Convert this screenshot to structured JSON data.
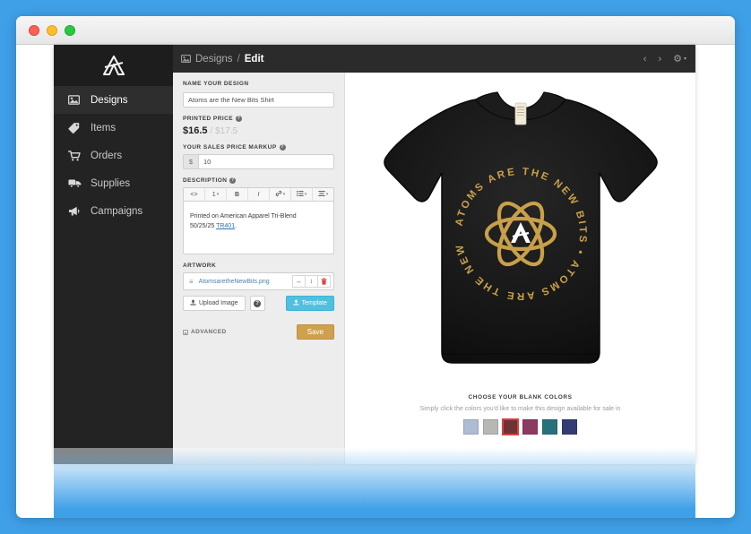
{
  "window": {
    "controls": [
      "close",
      "minimize",
      "maximize"
    ]
  },
  "sidebar": {
    "logo_name": "brand-logo",
    "items": [
      {
        "label": "Designs",
        "icon": "image-icon",
        "active": true
      },
      {
        "label": "Items",
        "icon": "tag-icon",
        "active": false
      },
      {
        "label": "Orders",
        "icon": "cart-icon",
        "active": false
      },
      {
        "label": "Supplies",
        "icon": "truck-icon",
        "active": false
      },
      {
        "label": "Campaigns",
        "icon": "megaphone-icon",
        "active": false
      }
    ]
  },
  "topbar": {
    "breadcrumb_icon": "image-icon",
    "breadcrumb_parent": "Designs",
    "breadcrumb_separator": "/",
    "breadcrumb_current": "Edit",
    "prev_label": "‹",
    "next_label": "›",
    "gear_label": "⚙",
    "gear_caret": "▾"
  },
  "form": {
    "name": {
      "label": "NAME YOUR DESIGN",
      "value": "Atoms are the New Bits Shirt",
      "placeholder": "Name your design"
    },
    "printed_price": {
      "label": "PRINTED PRICE",
      "info": "?",
      "value": "$16.5",
      "compare_value": "/ $17.5"
    },
    "markup": {
      "label": "YOUR SALES PRICE MARKUP",
      "info": "?",
      "currency": "$",
      "value": "10",
      "placeholder": "0"
    },
    "description": {
      "label": "DESCRIPTION",
      "info": "?",
      "toolbar": [
        {
          "name": "code-icon",
          "glyph": "<>",
          "caret": false
        },
        {
          "name": "heading-icon",
          "glyph": "1",
          "caret": true
        },
        {
          "name": "bold-icon",
          "glyph": "B",
          "caret": false
        },
        {
          "name": "italic-icon",
          "glyph": "I",
          "caret": false
        },
        {
          "name": "link-icon",
          "glyph": "🔗",
          "caret": true
        },
        {
          "name": "list-icon",
          "glyph": "≣",
          "caret": true
        },
        {
          "name": "align-icon",
          "glyph": "≡",
          "caret": true
        }
      ],
      "body_line1": "Printed on American Apparel Tri-Blend",
      "body_line2_prefix": "50/25/25 ",
      "body_link": "TR401",
      "body_line2_suffix": "."
    },
    "artwork": {
      "label": "ARTWORK",
      "drag_handle": "≡",
      "file_name": "AtomsaretheNewBits.png",
      "actions": [
        {
          "name": "fit-width-icon",
          "glyph": "↔"
        },
        {
          "name": "fit-height-icon",
          "glyph": "↕"
        },
        {
          "name": "delete-icon",
          "glyph": "🗑"
        }
      ],
      "upload_label": "Upload Image",
      "upload_icon": "upload-icon",
      "help_icon": "question-icon",
      "help_glyph": "?",
      "template_label": "Template",
      "template_icon": "download-icon"
    },
    "advanced_label": "ADVANCED",
    "save_label": "Save"
  },
  "preview": {
    "shirt_alt": "black-tshirt-front",
    "artwork_text": "ATOMS ARE THE NEW BITS • ATOMS ARE THE NEW BITS •",
    "artwork_mark": "atom-logo",
    "colors_title": "CHOOSE YOUR BLANK COLORS",
    "colors_subtitle": "Simply click the colors you'd like to make this design available for sale in",
    "swatches": [
      {
        "name": "swatch-light-blue",
        "hex": "#aebcd2",
        "selected": false
      },
      {
        "name": "swatch-grey",
        "hex": "#b7b8b4",
        "selected": false
      },
      {
        "name": "swatch-dark-red",
        "hex": "#6f3237",
        "selected": true
      },
      {
        "name": "swatch-magenta",
        "hex": "#8d3a63",
        "selected": false
      },
      {
        "name": "swatch-teal",
        "hex": "#28717a",
        "selected": false
      },
      {
        "name": "swatch-navy",
        "hex": "#333d72",
        "selected": false
      }
    ]
  },
  "theme": {
    "accent_blue": "#4fc0e0",
    "save_gold": "#cfa14e",
    "sidebar_bg": "#232323",
    "topbar_bg": "#2b2b2b",
    "page_bg": "#3fa0e8",
    "artwork_gold": "#c9a04a"
  }
}
